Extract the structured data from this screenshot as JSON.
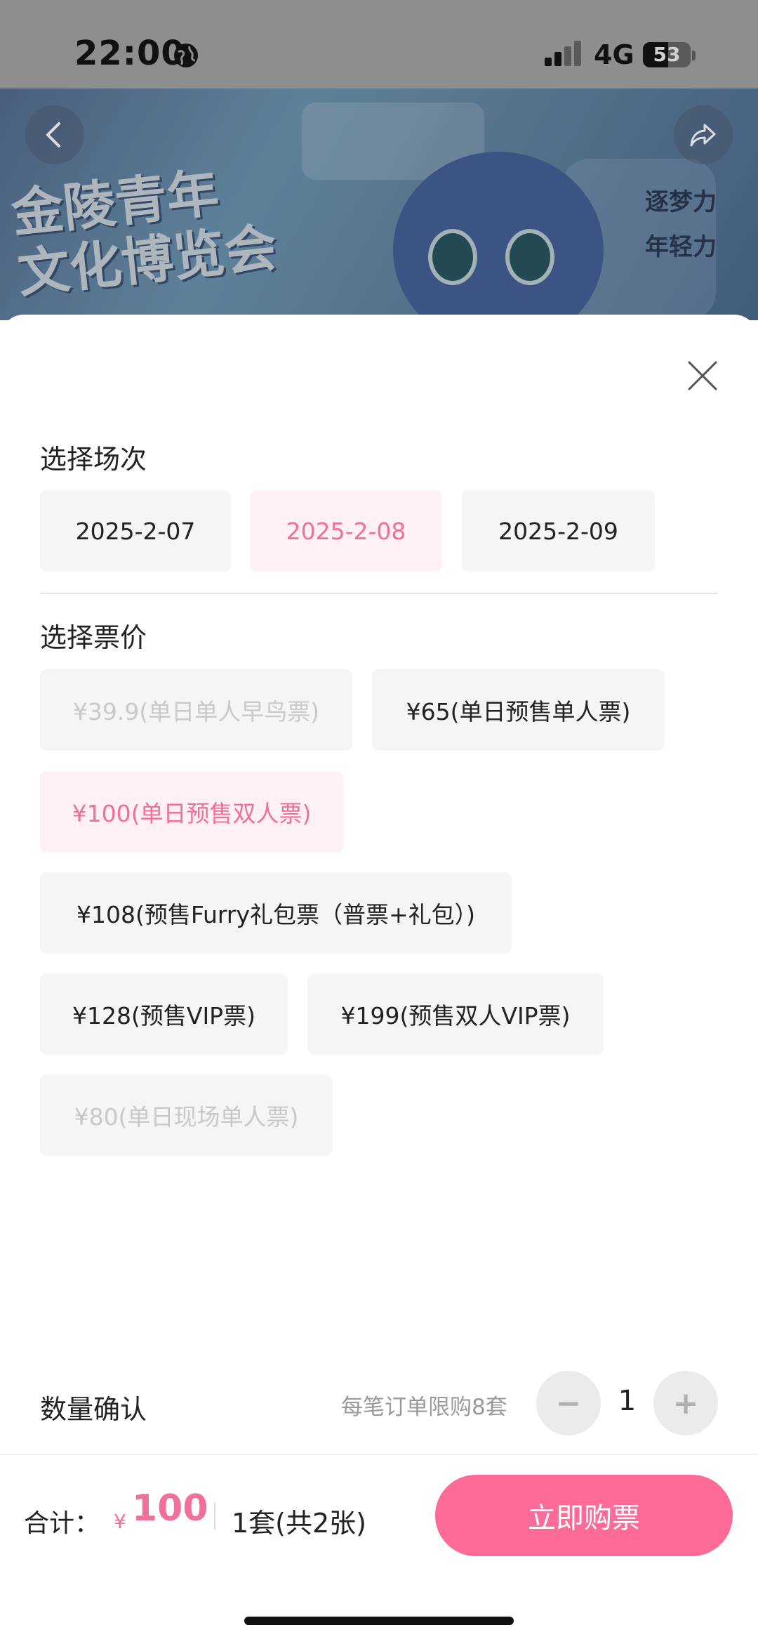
{
  "status_bar": {
    "time": "22:00",
    "network": "4G",
    "battery": "53",
    "battery_level_percent": 53,
    "signal_bars_active": 2,
    "signal_bars_total": 4
  },
  "banner": {
    "title_line1": "金陵青年",
    "title_line2": "文化博览会",
    "side_words": [
      "逐梦力",
      "年轻力"
    ],
    "back_icon": "chevron-left-icon",
    "share_icon": "share-icon"
  },
  "sheet": {
    "close_icon": "close-icon",
    "session_title": "选择场次",
    "sessions": [
      {
        "label": "2025-2-07",
        "state": "normal"
      },
      {
        "label": "2025-2-08",
        "state": "selected"
      },
      {
        "label": "2025-2-09",
        "state": "normal"
      }
    ],
    "price_title": "选择票价",
    "prices": [
      {
        "label": "¥39.9(单日单人早鸟票)",
        "state": "disabled"
      },
      {
        "label": "¥65(单日预售单人票)",
        "state": "normal"
      },
      {
        "label": "¥100(单日预售双人票)",
        "state": "selected"
      },
      {
        "label": "¥108(预售Furry礼包票（普票+礼包）)",
        "state": "normal"
      },
      {
        "label": "¥128(预售VIP票)",
        "state": "normal"
      },
      {
        "label": "¥199(预售双人VIP票)",
        "state": "normal"
      },
      {
        "label": "¥80(单日现场单人票)",
        "state": "disabled"
      }
    ],
    "quantity": {
      "label": "数量确认",
      "limit_text": "每笔订单限购8套",
      "minus": "−",
      "plus": "+",
      "value": "1"
    },
    "total": {
      "label": "合计：",
      "currency": "¥",
      "amount": "100",
      "count_text": "1套(共2张)"
    },
    "buy_button": "立即购票"
  },
  "colors": {
    "accent": "#ff6b97",
    "selected_text": "#f0709a",
    "selected_bg": "#fff0f3",
    "chip_bg": "#f5f5f5",
    "disabled_text": "#c9c9c9"
  }
}
